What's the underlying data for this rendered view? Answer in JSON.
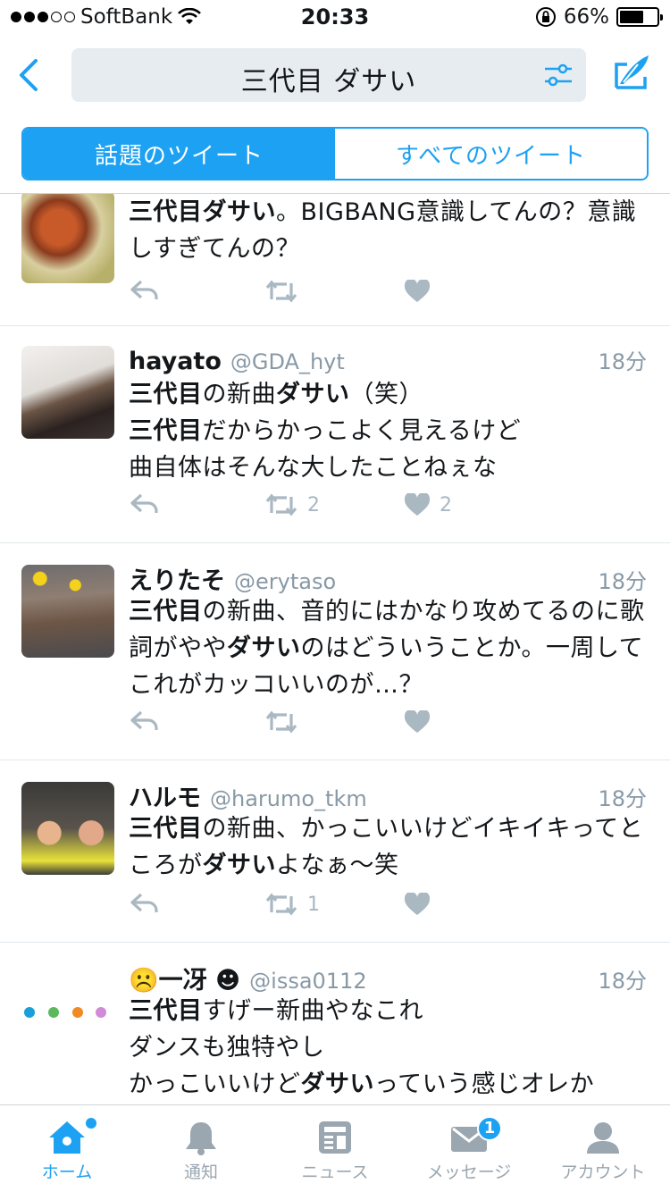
{
  "status": {
    "carrier": "SoftBank",
    "time": "20:33",
    "battery": "66%",
    "battery_level": 0.66
  },
  "header": {
    "query": "三代目 ダサい"
  },
  "tabs": {
    "top": "話題のツイート",
    "all": "すべてのツイート"
  },
  "tweets": [
    {
      "name": "",
      "handle": "",
      "time": "",
      "text_html": "<b>三代目ダサい</b>。BIGBANG意識してんの？意識しすぎてんの？",
      "reply": "",
      "retweets": "",
      "likes": ""
    },
    {
      "name": "hayato",
      "handle": "@GDA_hyt",
      "time": "18分",
      "text_html": "<b>三代目</b>の新曲<b>ダサい</b>（笑）<br><b>三代目</b>だからかっこよく見えるけど<br>曲自体はそんな大したことねぇな",
      "retweets": "2",
      "likes": "2"
    },
    {
      "name": "えりたそ",
      "handle": "@erytaso",
      "time": "18分",
      "text_html": "<b>三代目</b>の新曲、音的にはかなり攻めてるのに歌詞がやや<b>ダサい</b>のはどういうことか。一周してこれがカッコいいのが…？",
      "retweets": "",
      "likes": ""
    },
    {
      "name": "ハルモ",
      "handle": "@harumo_tkm",
      "time": "18分",
      "text_html": "<b>三代目</b>の新曲、かっこいいけどイキイキってところが<b>ダサい</b>よなぁ〜笑",
      "retweets": "1",
      "likes": ""
    },
    {
      "name": "☹️一冴 ☻",
      "handle": "@issa0112",
      "time": "18分",
      "text_html": "<b>三代目</b>すげー新曲やなこれ<br>ダンスも独特やし<br>かっこいいけど<b>ダサい</b>っていう感じオレか",
      "retweets": "",
      "likes": ""
    }
  ],
  "tabbar": {
    "home": "ホーム",
    "notifications": "通知",
    "news": "ニュース",
    "messages": "メッセージ",
    "messages_badge": "1",
    "account": "アカウント"
  },
  "colors": {
    "accent": "#1da1f2",
    "muted": "#aab8c2",
    "text": "#14171a"
  }
}
